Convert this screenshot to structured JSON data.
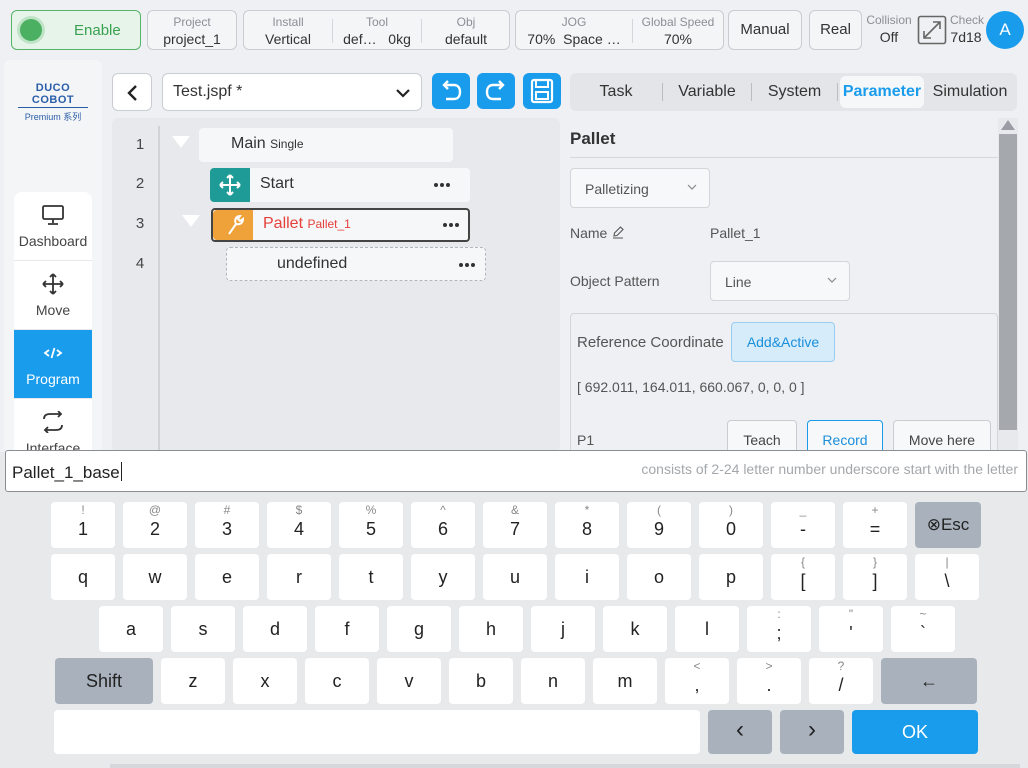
{
  "topbar": {
    "enable": "Enable",
    "project": {
      "caption": "Project",
      "value": "project_1"
    },
    "install": {
      "caption": "Install",
      "value": "Vertical"
    },
    "tool": {
      "caption": "Tool",
      "value": "def…",
      "value2": "0kg"
    },
    "obj": {
      "caption": "Obj",
      "value": "default"
    },
    "jog": {
      "caption": "JOG",
      "value": "70%",
      "value2": "Space …"
    },
    "global_speed": {
      "caption": "Global Speed",
      "value": "70%"
    },
    "mode": "Manual",
    "real": "Real",
    "collision": {
      "caption": "Collision",
      "value": "Off"
    },
    "check": {
      "caption": "Check",
      "value": "7d18"
    },
    "avatar": "A"
  },
  "logo": {
    "main": "DUCO COBOT",
    "sub": "Premium 系列"
  },
  "nav": {
    "items": [
      {
        "label": "Dashboard",
        "icon": "monitor-icon"
      },
      {
        "label": "Move",
        "icon": "move-arrows-icon"
      },
      {
        "label": "Program",
        "icon": "code-icon",
        "active": true
      },
      {
        "label": "Interface",
        "icon": "swap-arrows-icon"
      }
    ]
  },
  "program": {
    "file": "Test.jspf *",
    "lines": [
      "1",
      "2",
      "3",
      "4"
    ],
    "main": {
      "title": "Main",
      "sub": "Single"
    },
    "start": "Start",
    "pallet": {
      "title": "Pallet",
      "sub": "Pallet_1"
    },
    "undefined": "undefined"
  },
  "tabs": [
    "Task",
    "Variable",
    "System",
    "Parameter",
    "Simulation"
  ],
  "active_tab": "Parameter",
  "pallet_panel": {
    "title": "Pallet",
    "mode": "Palletizing",
    "name_label": "Name",
    "name_value": "Pallet_1",
    "pattern_label": "Object Pattern",
    "pattern_value": "Line",
    "ref_label": "Reference Coordinate",
    "ref_button": "Add&Active",
    "ref_value": "[ 692.011, 164.011, 660.067, 0, 0, 0 ]",
    "p1_label": "P1",
    "teach": "Teach",
    "record": "Record",
    "move_here": "Move here"
  },
  "input": {
    "value": "Pallet_1_base",
    "hint": "consists of 2-24 letter number underscore start with the letter"
  },
  "keyboard": {
    "row1": [
      {
        "top": "!",
        "main": "1"
      },
      {
        "top": "@",
        "main": "2"
      },
      {
        "top": "#",
        "main": "3"
      },
      {
        "top": "$",
        "main": "4"
      },
      {
        "top": "%",
        "main": "5"
      },
      {
        "top": "^",
        "main": "6"
      },
      {
        "top": "&",
        "main": "7"
      },
      {
        "top": "*",
        "main": "8"
      },
      {
        "top": "(",
        "main": "9"
      },
      {
        "top": ")",
        "main": "0"
      },
      {
        "top": "_",
        "main": "-"
      },
      {
        "top": "+",
        "main": "="
      }
    ],
    "esc": "⊗Esc",
    "row2": [
      {
        "top": "",
        "main": "q"
      },
      {
        "top": "",
        "main": "w"
      },
      {
        "top": "",
        "main": "e"
      },
      {
        "top": "",
        "main": "r"
      },
      {
        "top": "",
        "main": "t"
      },
      {
        "top": "",
        "main": "y"
      },
      {
        "top": "",
        "main": "u"
      },
      {
        "top": "",
        "main": "i"
      },
      {
        "top": "",
        "main": "o"
      },
      {
        "top": "",
        "main": "p"
      },
      {
        "top": "{",
        "main": "["
      },
      {
        "top": "}",
        "main": "]"
      },
      {
        "top": "|",
        "main": "\\"
      }
    ],
    "row3": [
      {
        "top": "",
        "main": "a"
      },
      {
        "top": "",
        "main": "s"
      },
      {
        "top": "",
        "main": "d"
      },
      {
        "top": "",
        "main": "f"
      },
      {
        "top": "",
        "main": "g"
      },
      {
        "top": "",
        "main": "h"
      },
      {
        "top": "",
        "main": "j"
      },
      {
        "top": "",
        "main": "k"
      },
      {
        "top": "",
        "main": "l"
      },
      {
        "top": ":",
        "main": ";"
      },
      {
        "top": "\"",
        "main": "'"
      },
      {
        "top": "~",
        "main": "`"
      }
    ],
    "shift": "Shift",
    "row4": [
      {
        "top": "",
        "main": "z"
      },
      {
        "top": "",
        "main": "x"
      },
      {
        "top": "",
        "main": "c"
      },
      {
        "top": "",
        "main": "v"
      },
      {
        "top": "",
        "main": "b"
      },
      {
        "top": "",
        "main": "n"
      },
      {
        "top": "",
        "main": "m"
      },
      {
        "top": "<",
        "main": ","
      },
      {
        "top": ">",
        "main": "."
      },
      {
        "top": "?",
        "main": "/"
      }
    ],
    "backspace": "←",
    "left": "‹",
    "right": "›",
    "ok": "OK"
  },
  "colors": {
    "accent": "#1a9cec",
    "enable_green": "#4cb062",
    "node_teal": "#1e9b96",
    "node_orange": "#f0a23a",
    "pallet_red": "#e5403a"
  }
}
